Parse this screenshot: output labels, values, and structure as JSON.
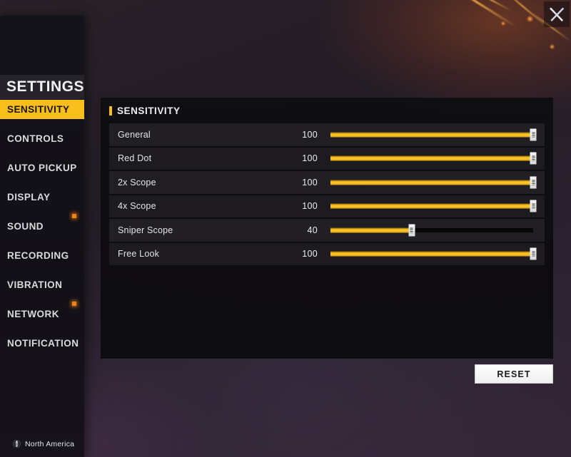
{
  "window": {
    "close_icon": "close-icon"
  },
  "sidebar": {
    "title": "SETTINGS",
    "items": [
      {
        "label": "SENSITIVITY",
        "active": true,
        "badge": false
      },
      {
        "label": "CONTROLS",
        "active": false,
        "badge": false
      },
      {
        "label": "AUTO PICKUP",
        "active": false,
        "badge": false
      },
      {
        "label": "DISPLAY",
        "active": false,
        "badge": false
      },
      {
        "label": "SOUND",
        "active": false,
        "badge": true
      },
      {
        "label": "RECORDING",
        "active": false,
        "badge": false
      },
      {
        "label": "VIBRATION",
        "active": false,
        "badge": false
      },
      {
        "label": "NETWORK",
        "active": false,
        "badge": true
      },
      {
        "label": "NOTIFICATION",
        "active": false,
        "badge": false
      }
    ],
    "region": {
      "icon": "globe-icon",
      "label": "North America"
    }
  },
  "panel": {
    "title": "SENSITIVITY",
    "slider_min": 0,
    "slider_max": 100,
    "rows": [
      {
        "label": "General",
        "value": 100
      },
      {
        "label": "Red Dot",
        "value": 100
      },
      {
        "label": "2x Scope",
        "value": 100
      },
      {
        "label": "4x Scope",
        "value": 100
      },
      {
        "label": "Sniper Scope",
        "value": 40
      },
      {
        "label": "Free Look",
        "value": 100
      }
    ]
  },
  "actions": {
    "reset_label": "RESET"
  },
  "colors": {
    "accent": "#F8BF1C",
    "slider_fill": "#F3B618",
    "badge": "#F08318",
    "panel_bg": "#0E0D10",
    "sidebar_bg": "#14121A"
  }
}
